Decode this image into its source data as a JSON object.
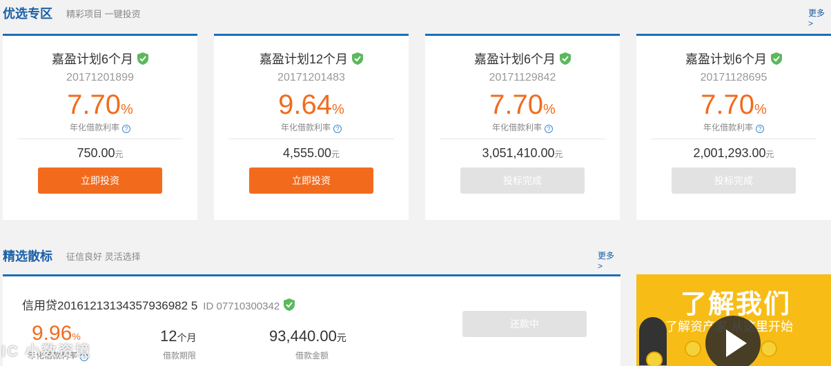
{
  "featured": {
    "title": "优选专区",
    "subtitle": "精彩项目   一键投资",
    "more": "更多 >",
    "cards": [
      {
        "name": "嘉盈计划6个月",
        "id": "20171201899",
        "rate": "7.70",
        "rate_unit": "%",
        "rate_label": "年化借款利率",
        "amount": "750.00",
        "amount_unit": "元",
        "button": "立即投资",
        "button_state": "active"
      },
      {
        "name": "嘉盈计划12个月",
        "id": "20171201483",
        "rate": "9.64",
        "rate_unit": "%",
        "rate_label": "年化借款利率",
        "amount": "4,555.00",
        "amount_unit": "元",
        "button": "立即投资",
        "button_state": "active"
      },
      {
        "name": "嘉盈计划6个月",
        "id": "20171129842",
        "rate": "7.70",
        "rate_unit": "%",
        "rate_label": "年化借款利率",
        "amount": "3,051,410.00",
        "amount_unit": "元",
        "button": "投标完成",
        "button_state": "disabled"
      },
      {
        "name": "嘉盈计划6个月",
        "id": "20171128695",
        "rate": "7.70",
        "rate_unit": "%",
        "rate_label": "年化借款利率",
        "amount": "2,001,293.00",
        "amount_unit": "元",
        "button": "投标完成",
        "button_state": "disabled"
      }
    ]
  },
  "loans": {
    "title": "精选散标",
    "subtitle": "征信良好   灵活选择",
    "more": "更多 >",
    "item": {
      "name": "信用贷20161213134357936982 5",
      "id_text": "ID 07710300342",
      "rate": "9.96",
      "rate_unit": "%",
      "rate_label": "年化借款利率",
      "term": "12",
      "term_unit": "个月",
      "term_label": "借款期限",
      "amount": "93,440.00",
      "amount_unit": "元",
      "amount_label": "借款金额",
      "button": "还款中"
    }
  },
  "promo": {
    "title": "了解我们",
    "subtitle": "了解资产家 从这里开始"
  },
  "watermark": "IC 小数资境",
  "colors": {
    "accent": "#f26b1d",
    "brand": "#1a5fa8",
    "promo_bg": "#f7bd16"
  }
}
